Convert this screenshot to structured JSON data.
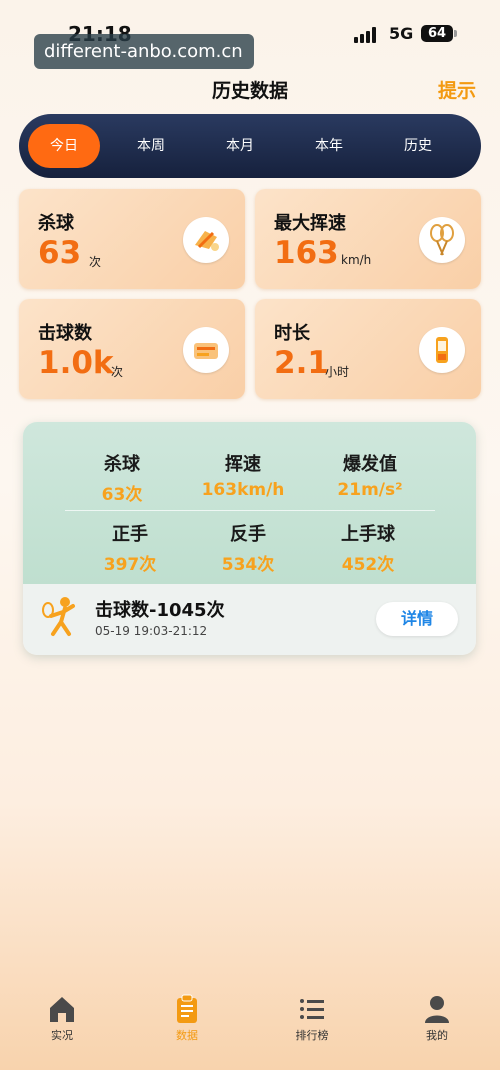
{
  "status": {
    "time": "21:18",
    "network": "5G",
    "battery": "64"
  },
  "watermark": "different-anbo.com.cn",
  "header": {
    "title": "历史数据",
    "hint": "提示"
  },
  "tabs": [
    {
      "label": "今日",
      "active": true
    },
    {
      "label": "本周",
      "active": false
    },
    {
      "label": "本月",
      "active": false
    },
    {
      "label": "本年",
      "active": false
    },
    {
      "label": "历史",
      "active": false
    }
  ],
  "stats": [
    {
      "label": "杀球",
      "value": "63",
      "unit": "次",
      "icon": "smash-icon"
    },
    {
      "label": "最大挥速",
      "value": "163",
      "unit": "km/h",
      "icon": "racket-icon"
    },
    {
      "label": "击球数",
      "value": "1.0k",
      "unit": "次",
      "icon": "shuttle-icon"
    },
    {
      "label": "时长",
      "value": "2.1",
      "unit": "小时",
      "icon": "timer-icon"
    }
  ],
  "session": {
    "metrics": [
      {
        "label": "杀球",
        "value": "63次"
      },
      {
        "label": "挥速",
        "value": "163km/h"
      },
      {
        "label": "爆发值",
        "value": "21m/s²"
      },
      {
        "label": "正手",
        "value": "397次"
      },
      {
        "label": "反手",
        "value": "534次"
      },
      {
        "label": "上手球",
        "value": "452次"
      }
    ],
    "title": "击球数-1045次",
    "time_range": "05-19 19:03-21:12",
    "detail_label": "详情"
  },
  "nav": [
    {
      "label": "实况",
      "icon": "home-icon",
      "active": false
    },
    {
      "label": "数据",
      "icon": "clipboard-icon",
      "active": true
    },
    {
      "label": "排行榜",
      "icon": "ranking-list-icon",
      "active": false
    },
    {
      "label": "我的",
      "icon": "user-icon",
      "active": false
    }
  ],
  "colors": {
    "accent": "#ff6a12",
    "hint": "#f39a12",
    "value_orange": "#f26d12",
    "metric_yellow": "#f7a21e",
    "link_blue": "#1f86e6"
  }
}
